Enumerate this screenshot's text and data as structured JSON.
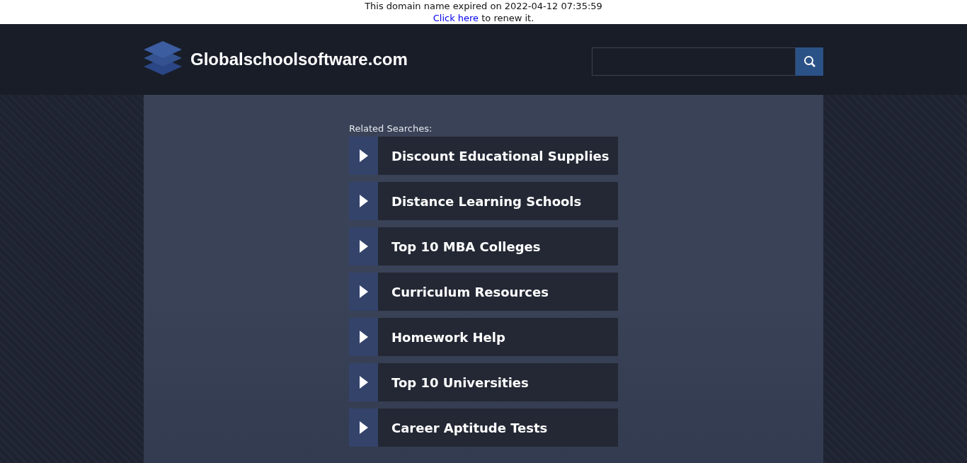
{
  "notice": {
    "message": "This domain name expired on 2022-04-12 07:35:59",
    "link": "Click here",
    "after_link": " to renew it."
  },
  "header": {
    "site_name": "Globalschoolsoftware.com"
  },
  "related": {
    "heading": "Related Searches:",
    "items": [
      {
        "label": "Discount Educational Supplies"
      },
      {
        "label": "Distance Learning Schools"
      },
      {
        "label": "Top 10 MBA Colleges"
      },
      {
        "label": "Curriculum Resources"
      },
      {
        "label": "Homework Help"
      },
      {
        "label": "Top 10 Universities"
      },
      {
        "label": "Career Aptitude Tests"
      }
    ]
  }
}
